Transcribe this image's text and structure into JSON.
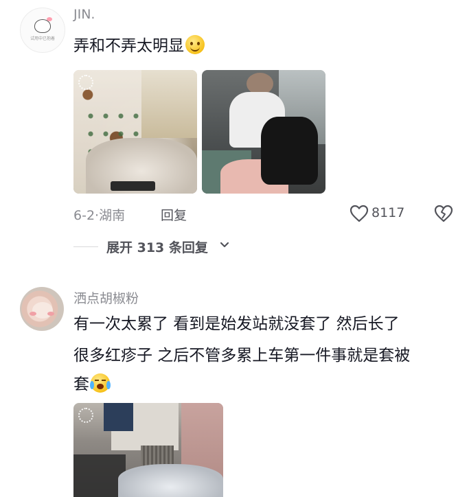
{
  "comments": [
    {
      "avatar_caption": "试用中已抱着",
      "username": "JIN.",
      "text": "弄和不弄太明显",
      "emoji": "smile-emoji",
      "date": "6-2",
      "location": "湖南",
      "reply_label": "回复",
      "likes": "8117",
      "expand_label": "展开 313 条回复"
    },
    {
      "username": "洒点胡椒粉",
      "text_lines": [
        "有一次太累了 看到是始发站就没套了 然后长了",
        "很多红疹子 之后不管多累上车第一件事就是套被",
        "套"
      ],
      "emoji": "crying-emoji"
    }
  ],
  "icons": {
    "like": "heart-outline-icon",
    "dislike": "broken-heart-icon",
    "expand": "chevron-down-icon"
  }
}
